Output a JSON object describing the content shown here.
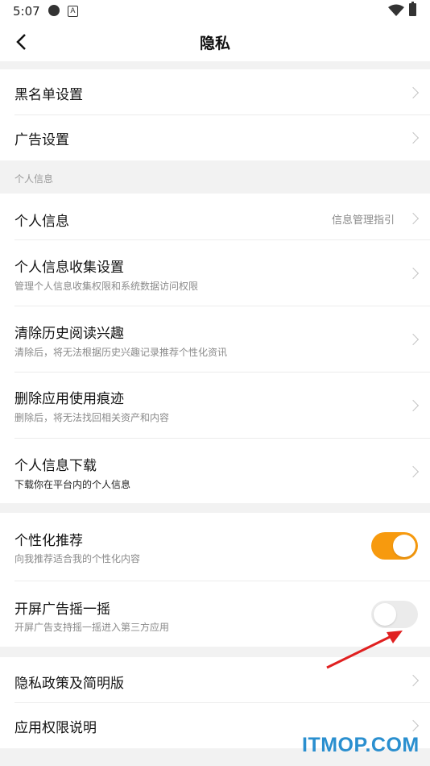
{
  "status_bar": {
    "time": "5:07",
    "notif_icon": "A"
  },
  "header": {
    "title": "隐私"
  },
  "group1": {
    "items": [
      {
        "label": "黑名单设置"
      },
      {
        "label": "广告设置"
      }
    ]
  },
  "section_personal": {
    "title": "个人信息"
  },
  "group2": {
    "items": [
      {
        "label": "个人信息",
        "hint": "信息管理指引"
      },
      {
        "label": "个人信息收集设置",
        "sub": "管理个人信息收集权限和系统数据访问权限"
      },
      {
        "label": "清除历史阅读兴趣",
        "sub": "清除后，将无法根据历史兴趣记录推荐个性化资讯"
      },
      {
        "label": "删除应用使用痕迹",
        "sub": "删除后，将无法找回相关资产和内容"
      },
      {
        "label": "个人信息下载",
        "sub": "下载你在平台内的个人信息"
      }
    ]
  },
  "group3": {
    "items": [
      {
        "label": "个性化推荐",
        "sub": "向我推荐适合我的个性化内容",
        "toggle": "on"
      },
      {
        "label": "开屏广告摇一摇",
        "sub": "开屏广告支持摇一摇进入第三方应用",
        "toggle": "off"
      }
    ]
  },
  "group4": {
    "items": [
      {
        "label": "隐私政策及简明版"
      },
      {
        "label": "应用权限说明"
      }
    ]
  },
  "watermark": "ITMOP.COM",
  "colors": {
    "accent": "#f79a0e",
    "watermark": "#2a8fcf",
    "annotation": "#e02020"
  }
}
